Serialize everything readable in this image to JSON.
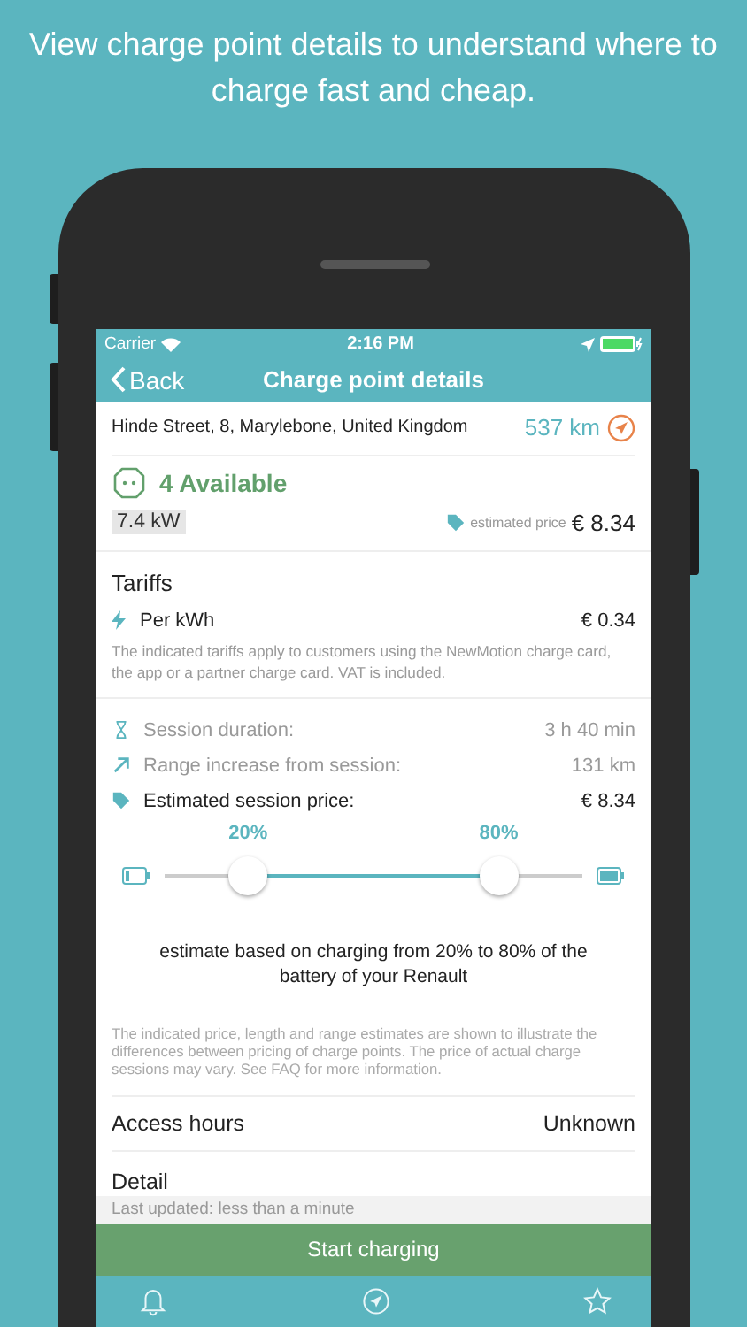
{
  "headline": "View charge point details to understand where to charge fast and cheap.",
  "status_bar": {
    "carrier": "Carrier",
    "time": "2:16 PM"
  },
  "nav": {
    "back": "Back",
    "title": "Charge point details"
  },
  "location": {
    "address": "Hinde Street, 8, Marylebone, United Kingdom",
    "distance": "537 km"
  },
  "availability": {
    "label": "4 Available",
    "power": "7.4 kW",
    "price_label": "estimated price",
    "price": "€ 8.34"
  },
  "tariffs": {
    "title": "Tariffs",
    "items": [
      {
        "label": "Per kWh",
        "value": "€ 0.34"
      }
    ],
    "note": "The indicated tariffs apply to customers using the NewMotion charge card, the app or a partner charge card. VAT is included."
  },
  "session": {
    "rows": [
      {
        "kind": "duration",
        "label": "Session duration:",
        "value": "3 h 40 min",
        "emphasis": false
      },
      {
        "kind": "range",
        "label": "Range increase from session:",
        "value": "131 km",
        "emphasis": false
      },
      {
        "kind": "price",
        "label": "Estimated session price:",
        "value": "€ 8.34",
        "emphasis": true
      }
    ],
    "slider": {
      "low": {
        "level": 0.2,
        "reading": "20%"
      },
      "high": {
        "level": 0.8,
        "reading": "80%"
      }
    },
    "estimate": "estimate based on charging from 20% to 80% of the battery of your Renault",
    "disclaimer": "The indicated price, length and range estimates are shown to illustrate the differences between pricing of charge points. The price of actual charge sessions may vary. See FAQ for more information."
  },
  "details": [
    {
      "label": "Access hours",
      "value": "Unknown"
    }
  ],
  "cut_row": "Detail",
  "last_updated": "Last updated: less than a minute",
  "action": "Start charging",
  "tab_bar": [
    {
      "kind": "bell",
      "selected": false
    },
    {
      "kind": "navigate",
      "selected": false
    },
    {
      "kind": "star",
      "selected": false
    }
  ]
}
